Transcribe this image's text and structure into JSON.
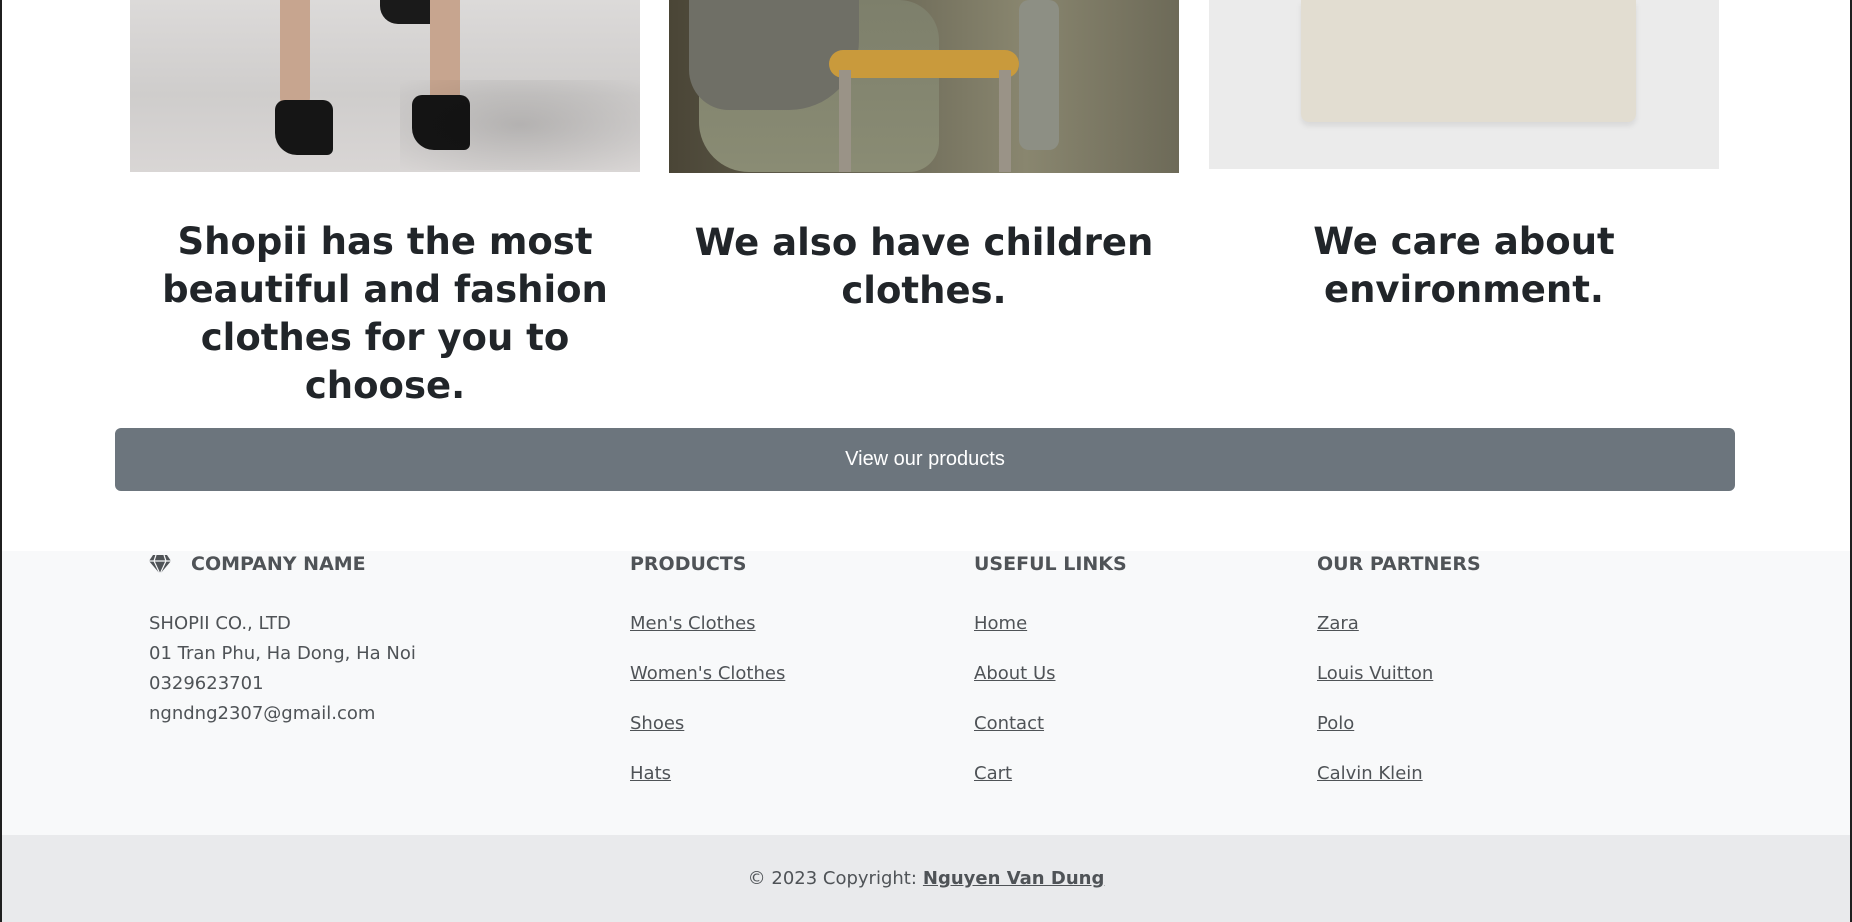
{
  "cards": [
    {
      "heading": "Shopii has the most beautiful and fashion clothes for you to choose.",
      "image": "high-heels-photo"
    },
    {
      "heading": "We also have children clothes.",
      "image": "child-on-chair-photo"
    },
    {
      "heading": "We care about environment.",
      "image": "plain-tshirt-photo"
    }
  ],
  "cta": {
    "label": "View our products"
  },
  "footer": {
    "company": {
      "title": "COMPANY NAME",
      "icon": "gem-icon",
      "lines": [
        "SHOPII CO., LTD",
        "01 Tran Phu, Ha Dong, Ha Noi",
        "0329623701",
        "ngndng2307@gmail.com"
      ]
    },
    "products": {
      "title": "PRODUCTS",
      "links": [
        "Men's Clothes",
        "Women's Clothes",
        "Shoes",
        "Hats"
      ]
    },
    "useful_links": {
      "title": "USEFUL LINKS",
      "links": [
        "Home",
        "About Us",
        "Contact",
        "Cart"
      ]
    },
    "partners": {
      "title": "OUR PARTNERS",
      "links": [
        "Zara",
        "Louis Vuitton",
        "Polo",
        "Calvin Klein"
      ]
    }
  },
  "copyright": {
    "text": "© 2023 Copyright:",
    "author": "Nguyen Van Dung"
  },
  "colors": {
    "button": "#6c757d",
    "footer_bg": "#f8f9fa",
    "copyright_bg": "#e9eaec",
    "text": "#4f5357"
  }
}
